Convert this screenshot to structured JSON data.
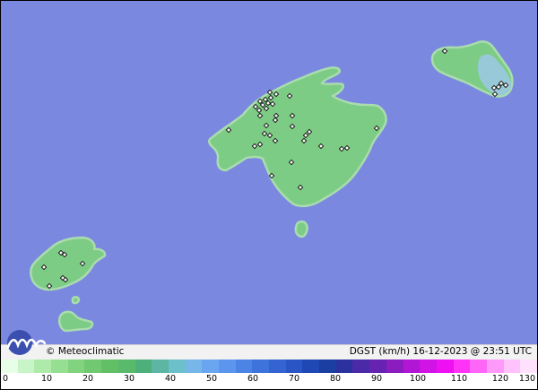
{
  "map": {
    "sea_color": "#7b88e0",
    "land_color": "#7dcc85",
    "land_color_low": "#86d48e",
    "coast_color": "#a9dcae",
    "east_tip_color": "#9cc8e6",
    "station_marker": "diamond"
  },
  "footer": {
    "logo_name": "meteoclimatic-logo",
    "brand": "© Meteoclimatic",
    "caption": "DGST (km/h)   16-12-2023 @ 23:51 UTC"
  },
  "legend": {
    "unit": "km/h",
    "min": 0,
    "max": 130,
    "colors": [
      "#e6ffe6",
      "#c8f5c8",
      "#aeeaa9",
      "#96de92",
      "#82d37f",
      "#70c970",
      "#63bf66",
      "#5aba6c",
      "#4db07a",
      "#5db6a4",
      "#6cc0c9",
      "#76b6e8",
      "#6aa6f0",
      "#5b95ee",
      "#4c84e6",
      "#3f73dc",
      "#3463d2",
      "#2a55c4",
      "#2048b4",
      "#1a3ea2",
      "#2b32a0",
      "#4a2aa6",
      "#6622b0",
      "#8a1cc0",
      "#b016d4",
      "#d014e6",
      "#ee10f2",
      "#ff33f5",
      "#ff66f7",
      "#ff99f9",
      "#ffc2fb",
      "#ffe0fd"
    ],
    "ticks": [
      "0",
      "10",
      "20",
      "30",
      "40",
      "50",
      "60",
      "70",
      "80",
      "90",
      "100",
      "110",
      "120",
      "130"
    ]
  }
}
